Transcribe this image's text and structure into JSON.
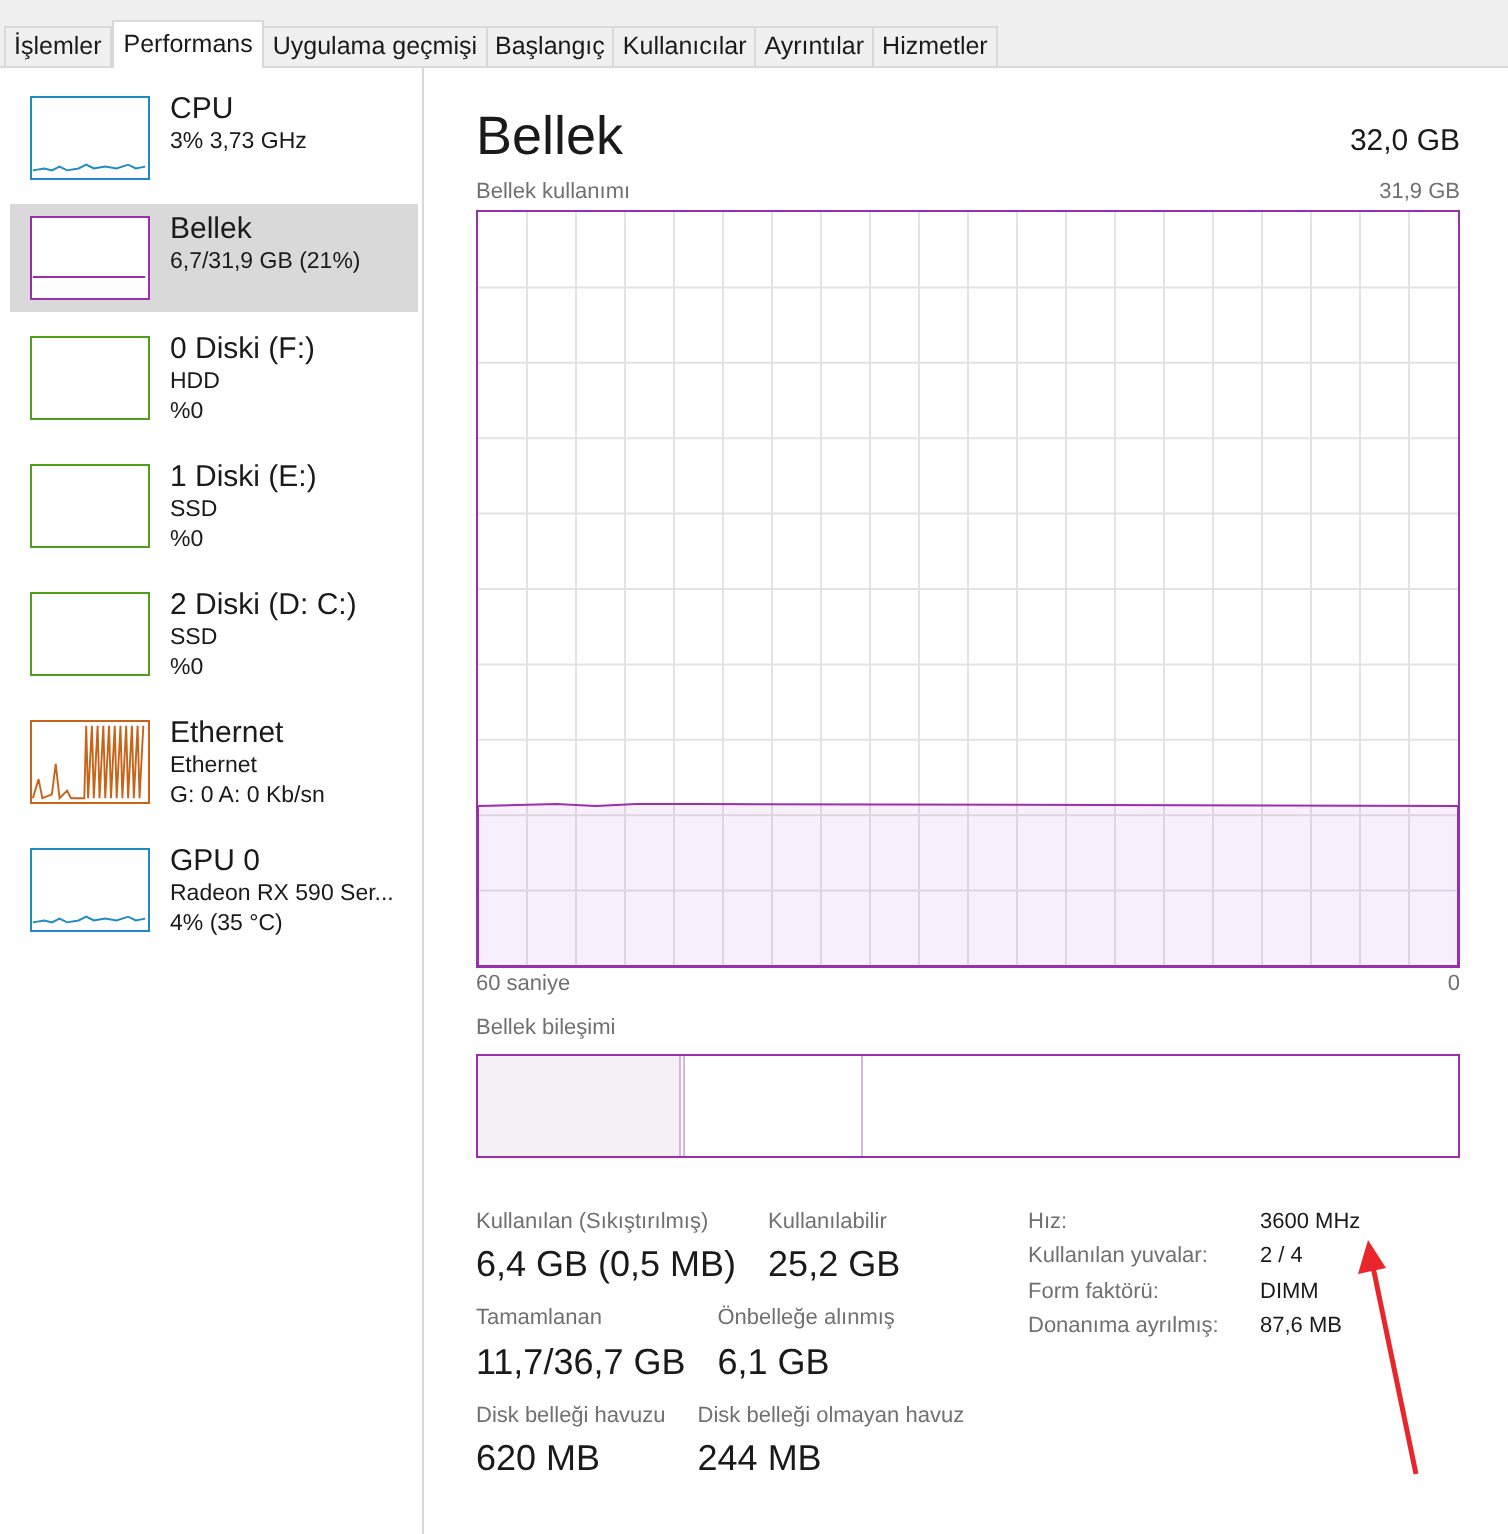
{
  "tabs": [
    {
      "label": "İşlemler",
      "selected": false
    },
    {
      "label": "Performans",
      "selected": true
    },
    {
      "label": "Uygulama geçmişi",
      "selected": false
    },
    {
      "label": "Başlangıç",
      "selected": false
    },
    {
      "label": "Kullanıcılar",
      "selected": false
    },
    {
      "label": "Ayrıntılar",
      "selected": false
    },
    {
      "label": "Hizmetler",
      "selected": false
    }
  ],
  "sidebar": {
    "items": [
      {
        "kind": "cpu",
        "name": "CPU",
        "lines": [
          "3% 3,73 GHz"
        ],
        "color": "#1f8bc4",
        "selected": false
      },
      {
        "kind": "memory",
        "name": "Bellek",
        "lines": [
          "6,7/31,9 GB (21%)"
        ],
        "color": "#9b2fae",
        "selected": true
      },
      {
        "kind": "disk",
        "name": "0 Diski (F:)",
        "lines": [
          "HDD",
          "%0"
        ],
        "color": "#4da01b",
        "selected": false
      },
      {
        "kind": "disk",
        "name": "1 Diski (E:)",
        "lines": [
          "SSD",
          "%0"
        ],
        "color": "#4da01b",
        "selected": false
      },
      {
        "kind": "disk",
        "name": "2 Diski (D: C:)",
        "lines": [
          "SSD",
          "%0"
        ],
        "color": "#4da01b",
        "selected": false
      },
      {
        "kind": "network",
        "name": "Ethernet",
        "lines": [
          "Ethernet",
          "G: 0 A: 0 Kb/sn"
        ],
        "color": "#c8641a",
        "selected": false
      },
      {
        "kind": "gpu",
        "name": "GPU 0",
        "lines": [
          "Radeon RX 590 Ser...",
          "4% (35 °C)"
        ],
        "color": "#1f8bc4",
        "selected": false
      }
    ]
  },
  "main": {
    "title": "Bellek",
    "total": "32,0 GB",
    "usage_graph": {
      "label": "Bellek kullanımı",
      "max": "31,9 GB",
      "start": "60 saniye",
      "end": "0"
    },
    "composition": {
      "label": "Bellek bileşimi"
    },
    "stats": [
      [
        {
          "label": "Kullanılan (Sıkıştırılmış)",
          "value": "6,4 GB (0,5 MB)"
        },
        {
          "label": "Kullanılabilir",
          "value": "25,2 GB"
        }
      ],
      [
        {
          "label": "Tamamlanan",
          "value": "11,7/36,7 GB"
        },
        {
          "label": "Önbelleğe alınmış",
          "value": "6,1 GB"
        }
      ],
      [
        {
          "label": "Disk belleği havuzu",
          "value": "620 MB"
        },
        {
          "label": "Disk belleği olmayan havuz",
          "value": "244 MB"
        }
      ]
    ],
    "details": [
      {
        "label": "Hız:",
        "value": "3600 MHz"
      },
      {
        "label": "Kullanılan yuvalar:",
        "value": "2 / 4"
      },
      {
        "label": "Form faktörü:",
        "value": "DIMM"
      },
      {
        "label": "Donanıma ayrılmış:",
        "value": "87,6 MB"
      }
    ]
  }
}
